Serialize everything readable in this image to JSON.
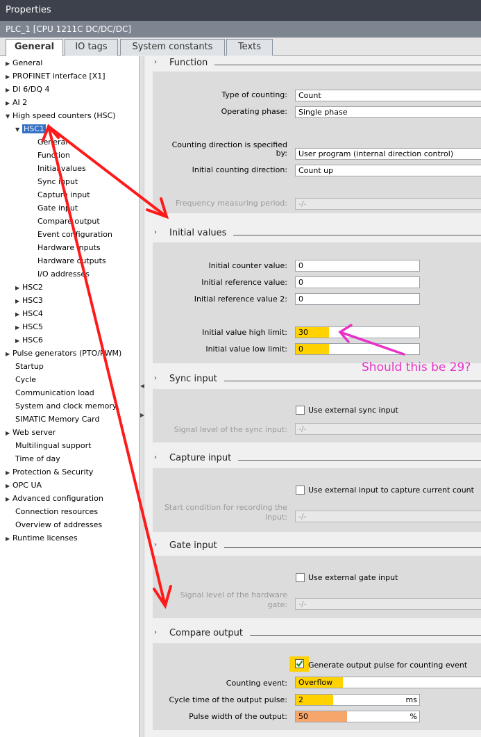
{
  "window": {
    "title": "Properties",
    "device": "PLC_1 [CPU 1211C DC/DC/DC]"
  },
  "tabs": [
    "General",
    "IO tags",
    "System constants",
    "Texts"
  ],
  "tree": [
    {
      "label": "General",
      "expander": "▶"
    },
    {
      "label": "PROFINET interface [X1]",
      "expander": "▶"
    },
    {
      "label": "DI 6/DQ 4",
      "expander": "▶"
    },
    {
      "label": "AI 2",
      "expander": "▶"
    },
    {
      "label": "High speed counters (HSC)",
      "expander": "▼"
    },
    {
      "label": "HSC1",
      "expander": "▼"
    },
    {
      "label": "General",
      "expander": ""
    },
    {
      "label": "Function",
      "expander": ""
    },
    {
      "label": "Initial values",
      "expander": ""
    },
    {
      "label": "Sync input",
      "expander": ""
    },
    {
      "label": "Capture input",
      "expander": ""
    },
    {
      "label": "Gate input",
      "expander": ""
    },
    {
      "label": "Compare output",
      "expander": ""
    },
    {
      "label": "Event configuration",
      "expander": ""
    },
    {
      "label": "Hardware inputs",
      "expander": ""
    },
    {
      "label": "Hardware outputs",
      "expander": ""
    },
    {
      "label": "I/O addresses",
      "expander": ""
    },
    {
      "label": "HSC2",
      "expander": "▶"
    },
    {
      "label": "HSC3",
      "expander": "▶"
    },
    {
      "label": "HSC4",
      "expander": "▶"
    },
    {
      "label": "HSC5",
      "expander": "▶"
    },
    {
      "label": "HSC6",
      "expander": "▶"
    },
    {
      "label": "Pulse generators (PTO/PWM)",
      "expander": "▶"
    },
    {
      "label": "Startup",
      "expander": ""
    },
    {
      "label": "Cycle",
      "expander": ""
    },
    {
      "label": "Communication load",
      "expander": ""
    },
    {
      "label": "System and clock memory",
      "expander": ""
    },
    {
      "label": "SIMATIC Memory Card",
      "expander": ""
    },
    {
      "label": "Web server",
      "expander": "▶"
    },
    {
      "label": "Multilingual support",
      "expander": ""
    },
    {
      "label": "Time of day",
      "expander": ""
    },
    {
      "label": "Protection & Security",
      "expander": "▶"
    },
    {
      "label": "OPC UA",
      "expander": "▶"
    },
    {
      "label": "Advanced configuration",
      "expander": "▶"
    },
    {
      "label": "Connection resources",
      "expander": ""
    },
    {
      "label": "Overview of addresses",
      "expander": ""
    },
    {
      "label": "Runtime licenses",
      "expander": "▶"
    }
  ],
  "sections": {
    "function": {
      "title": "Function",
      "type_label": "Type of counting:",
      "type_value": "Count",
      "phase_label": "Operating phase:",
      "phase_value": "Single phase",
      "direction_label_1": "Counting direction is specified",
      "direction_label_2": "by:",
      "direction_value": "User program (internal direction control)",
      "init_dir_label": "Initial counting direction:",
      "init_dir_value": "Count up",
      "freq_label": "Frequency measuring period:",
      "freq_value": "-/-"
    },
    "initial": {
      "title": "Initial values",
      "counter_label": "Initial counter value:",
      "counter_value": "0",
      "ref_label": "Initial reference value:",
      "ref_value": "0",
      "ref2_label": "Initial reference value 2:",
      "ref2_value": "0",
      "high_label": "Initial value high limit:",
      "high_value": "30",
      "low_label": "Initial value low limit:",
      "low_value": "0"
    },
    "sync": {
      "title": "Sync input",
      "check_label": "Use external sync input",
      "signal_label": "Signal level of the sync input:",
      "signal_value": "-/-"
    },
    "capture": {
      "title": "Capture input",
      "check_label": "Use external input to capture current count",
      "start_label_1": "Start condition for recording the",
      "start_label_2": "input:",
      "start_value": "-/-"
    },
    "gate": {
      "title": "Gate input",
      "check_label": "Use external gate input",
      "signal_label_1": "Signal level of the hardware",
      "signal_label_2": "gate:",
      "signal_value": "-/-"
    },
    "compare": {
      "title": "Compare output",
      "check_label": "Generate output pulse for counting event",
      "event_label": "Counting event:",
      "event_value": "Overflow",
      "cycle_label": "Cycle time of the output pulse:",
      "cycle_value": "2",
      "cycle_unit": "ms",
      "width_label": "Pulse width of the output:",
      "width_value": "50",
      "width_unit": "%"
    }
  },
  "annotation": {
    "note": "Should this be 29?",
    "arrow_color": "#ff1a1a",
    "note_color": "#e632c8"
  }
}
